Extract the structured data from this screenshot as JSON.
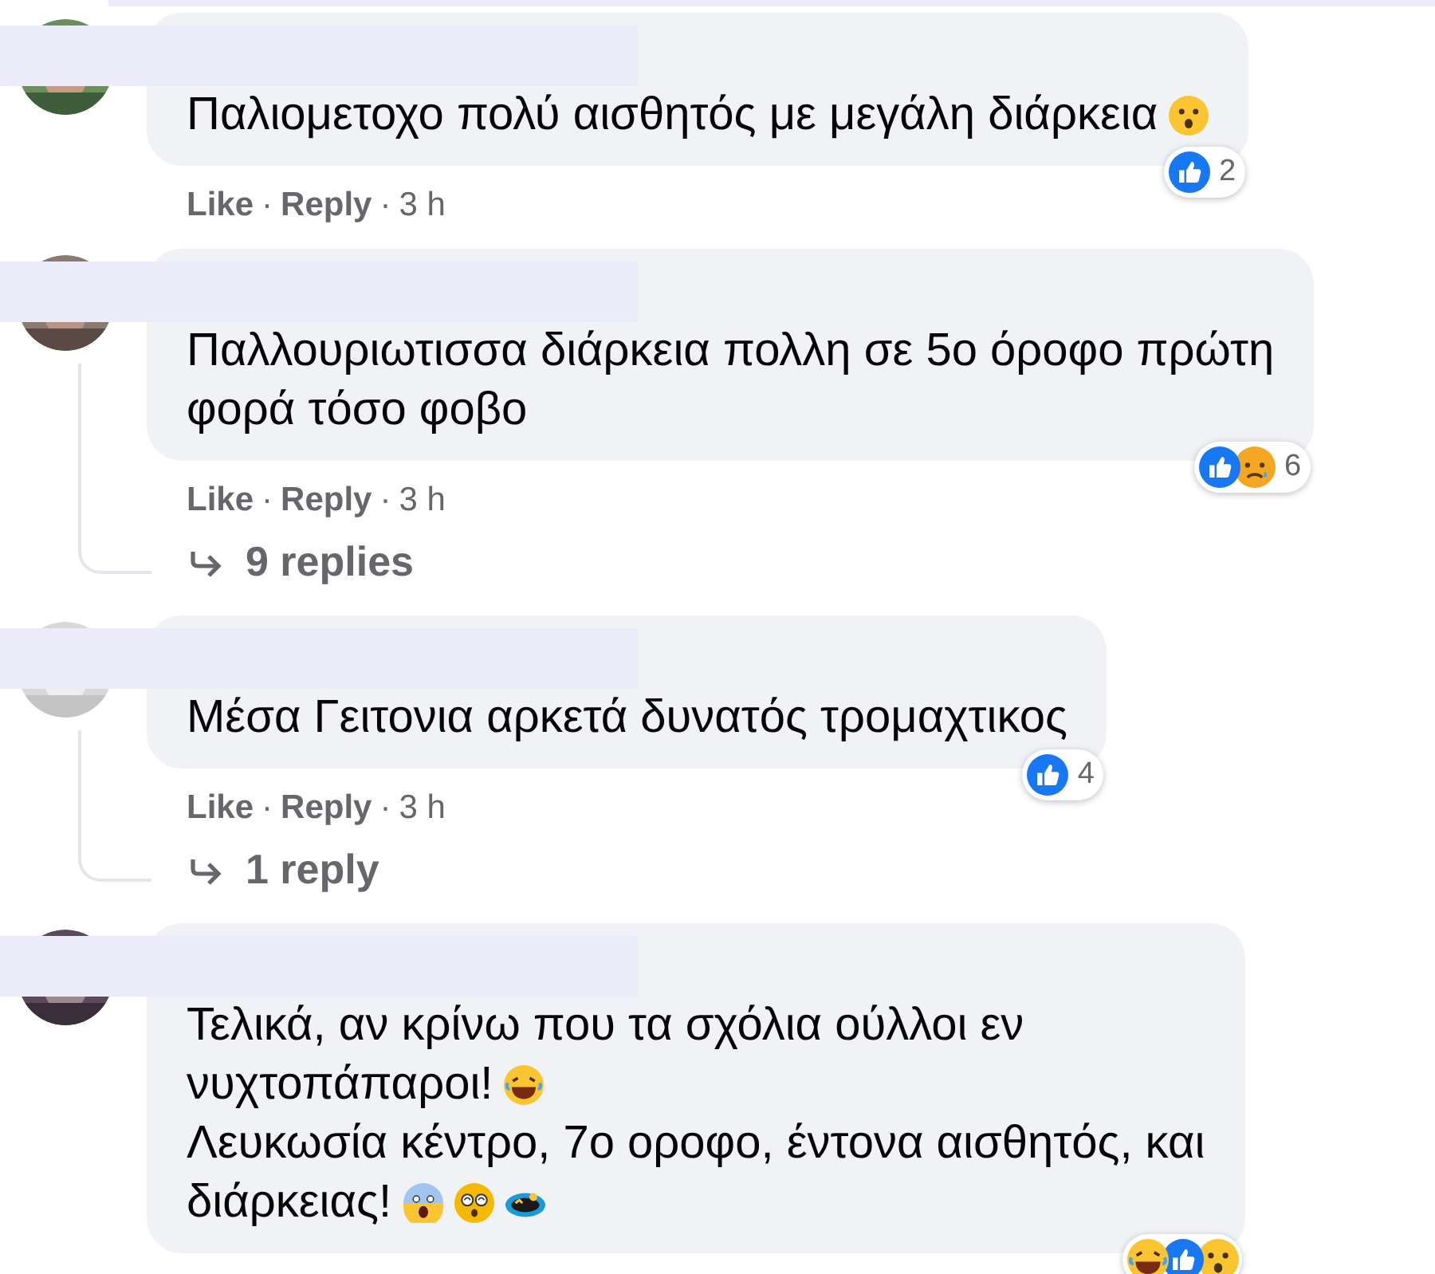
{
  "separator": "·",
  "comments": [
    {
      "lines": [
        [
          {
            "kind": "text",
            "text": "Παλιομετοχο πολύ αισθητός με μεγάλη διάρκεια"
          },
          {
            "kind": "hushed"
          }
        ]
      ],
      "actions": [
        "Like",
        "Reply"
      ],
      "time": "3 h",
      "reactions": [
        {
          "kind": "like"
        }
      ],
      "reaction_count": "2"
    },
    {
      "lines": [
        [
          {
            "kind": "text",
            "text": "Παλλουριωτισσα διάρκεια πολλη σε 5ο όροφο πρώτη"
          }
        ],
        [
          {
            "kind": "text",
            "text": "φορά τόσο φοβο"
          }
        ]
      ],
      "actions": [
        "Like",
        "Reply"
      ],
      "time": "3 h",
      "reactions": [
        {
          "kind": "like"
        },
        {
          "kind": "sad"
        }
      ],
      "reaction_count": "6",
      "replies": "9 replies"
    },
    {
      "lines": [
        [
          {
            "kind": "text",
            "text": "Μέσα Γειτονια αρκετά δυνατός τρομαχτικος"
          }
        ]
      ],
      "actions": [
        "Like",
        "Reply"
      ],
      "time": "3 h",
      "reactions": [
        {
          "kind": "like"
        }
      ],
      "reaction_count": "4",
      "replies": "1 reply"
    },
    {
      "lines": [
        [
          {
            "kind": "text",
            "text": "Τελικά, αν κρίνω που τα σχόλια ούλλοι εν"
          }
        ],
        [
          {
            "kind": "text",
            "text": "νυχτοπάπαροι!"
          },
          {
            "kind": "laugh"
          }
        ],
        [
          {
            "kind": "text",
            "text": "Λευκωσία κέντρο, 7ο οροφο, έντονα αισθητός, και"
          }
        ],
        [
          {
            "kind": "text",
            "text": "διάρκειας!"
          },
          {
            "kind": "scream"
          },
          {
            "kind": "flushed"
          },
          {
            "kind": "spin"
          }
        ]
      ],
      "reactions": [
        {
          "kind": "haha"
        },
        {
          "kind": "like"
        },
        {
          "kind": "wow"
        }
      ]
    }
  ]
}
